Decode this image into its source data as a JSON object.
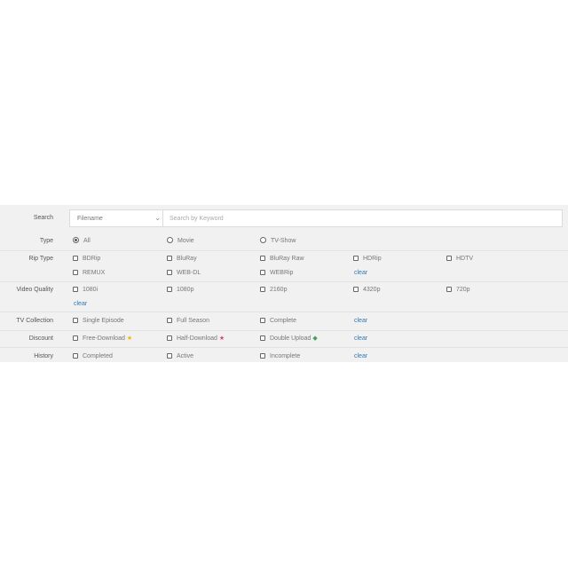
{
  "search": {
    "label": "Search",
    "field_select": "Filename",
    "placeholder": "Search by Keyword"
  },
  "type": {
    "label": "Type",
    "options": [
      {
        "label": "All",
        "selected": true
      },
      {
        "label": "Movie",
        "selected": false
      },
      {
        "label": "TV-Show",
        "selected": false
      }
    ]
  },
  "rip_type": {
    "label": "Rip Type",
    "options": [
      "BDRip",
      "BluRay",
      "BluRay Raw",
      "HDRip",
      "HDTV",
      "REMUX",
      "WEB-DL",
      "WEBRip"
    ],
    "clear": "clear"
  },
  "video_quality": {
    "label": "Video Quality",
    "options": [
      "1080i",
      "1080p",
      "2160p",
      "4320p",
      "720p"
    ],
    "clear": "clear"
  },
  "tv_collection": {
    "label": "TV Collection",
    "options": [
      "Single Episode",
      "Full Season",
      "Complete"
    ],
    "clear": "clear"
  },
  "discount": {
    "label": "Discount",
    "options": [
      {
        "label": "Free-Download",
        "icon": "star-icon",
        "color": "#f2b400"
      },
      {
        "label": "Half-Download",
        "icon": "half-star-icon",
        "color": "#d9486a"
      },
      {
        "label": "Double Upload",
        "icon": "diamond-icon",
        "color": "#3aa65a"
      }
    ],
    "clear": "clear"
  },
  "history": {
    "label": "History",
    "options": [
      "Completed",
      "Active",
      "Incomplete"
    ],
    "clear": "clear"
  }
}
